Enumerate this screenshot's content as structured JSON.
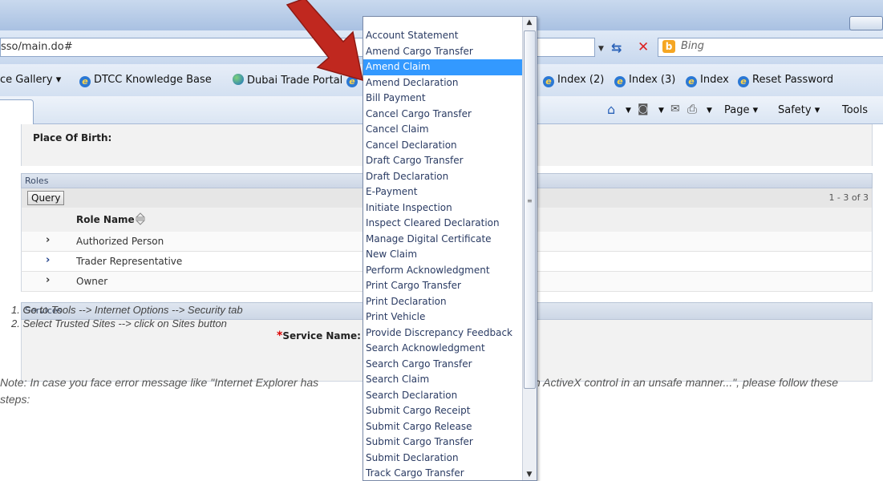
{
  "browser": {
    "address": "sso/main.do#",
    "search_provider": "Bing",
    "favorites": [
      "ce Gallery ▾",
      "DTCC Knowledge Base",
      "Dubai Trade Portal",
      "Index (2)",
      "Index (3)",
      "Index",
      "Reset Password"
    ],
    "commands": {
      "page": "Page ▾",
      "safety": "Safety ▾",
      "tools": "Tools"
    }
  },
  "form": {
    "place_of_birth_label": "Place Of Birth:",
    "roles_section": "Roles",
    "query_button": "Query",
    "pager": "1 - 3 of 3",
    "role_column": "Role Name",
    "roles": [
      "Authorized Person",
      "Trader Representative",
      "Owner"
    ],
    "services_section": "Services",
    "service_required": "*",
    "service_label": "Service Name:"
  },
  "note": {
    "line1_left": "Note: In case you face error message like \"Internet Explorer has",
    "line1_right": "n ActiveX control in an unsafe manner...\", please follow these",
    "line2": "steps:",
    "steps": [
      "1.   Go to Tools --> Internet Options --> Security tab",
      "2.   Select Trusted Sites --> click on Sites button"
    ]
  },
  "dropdown": {
    "selected": "Amend Claim",
    "options": [
      "Account Statement",
      "Amend Cargo Transfer",
      "Amend Claim",
      "Amend Declaration",
      "Bill Payment",
      "Cancel Cargo Transfer",
      "Cancel Claim",
      "Cancel Declaration",
      "Draft Cargo Transfer",
      "Draft Declaration",
      "E-Payment",
      "Initiate Inspection",
      "Inspect Cleared Declaration",
      "Manage Digital Certificate",
      "New Claim",
      "Perform Acknowledgment",
      "Print Cargo Transfer",
      "Print Declaration",
      "Print Vehicle",
      "Provide Discrepancy Feedback",
      "Search Acknowledgment",
      "Search Cargo Transfer",
      "Search Claim",
      "Search Declaration",
      "Submit Cargo Receipt",
      "Submit Cargo Release",
      "Submit Cargo Transfer",
      "Submit Declaration",
      "Track Cargo Transfer"
    ]
  },
  "colors": {
    "selection": "#3399ff",
    "arrow": "#c0281f",
    "required": "#dd0000"
  },
  "icons": [
    "ie-icon",
    "globe-icon",
    "bing-icon",
    "refresh-icon",
    "stop-icon",
    "home-icon",
    "rss-icon",
    "mail-icon",
    "print-icon",
    "sort-icon"
  ]
}
